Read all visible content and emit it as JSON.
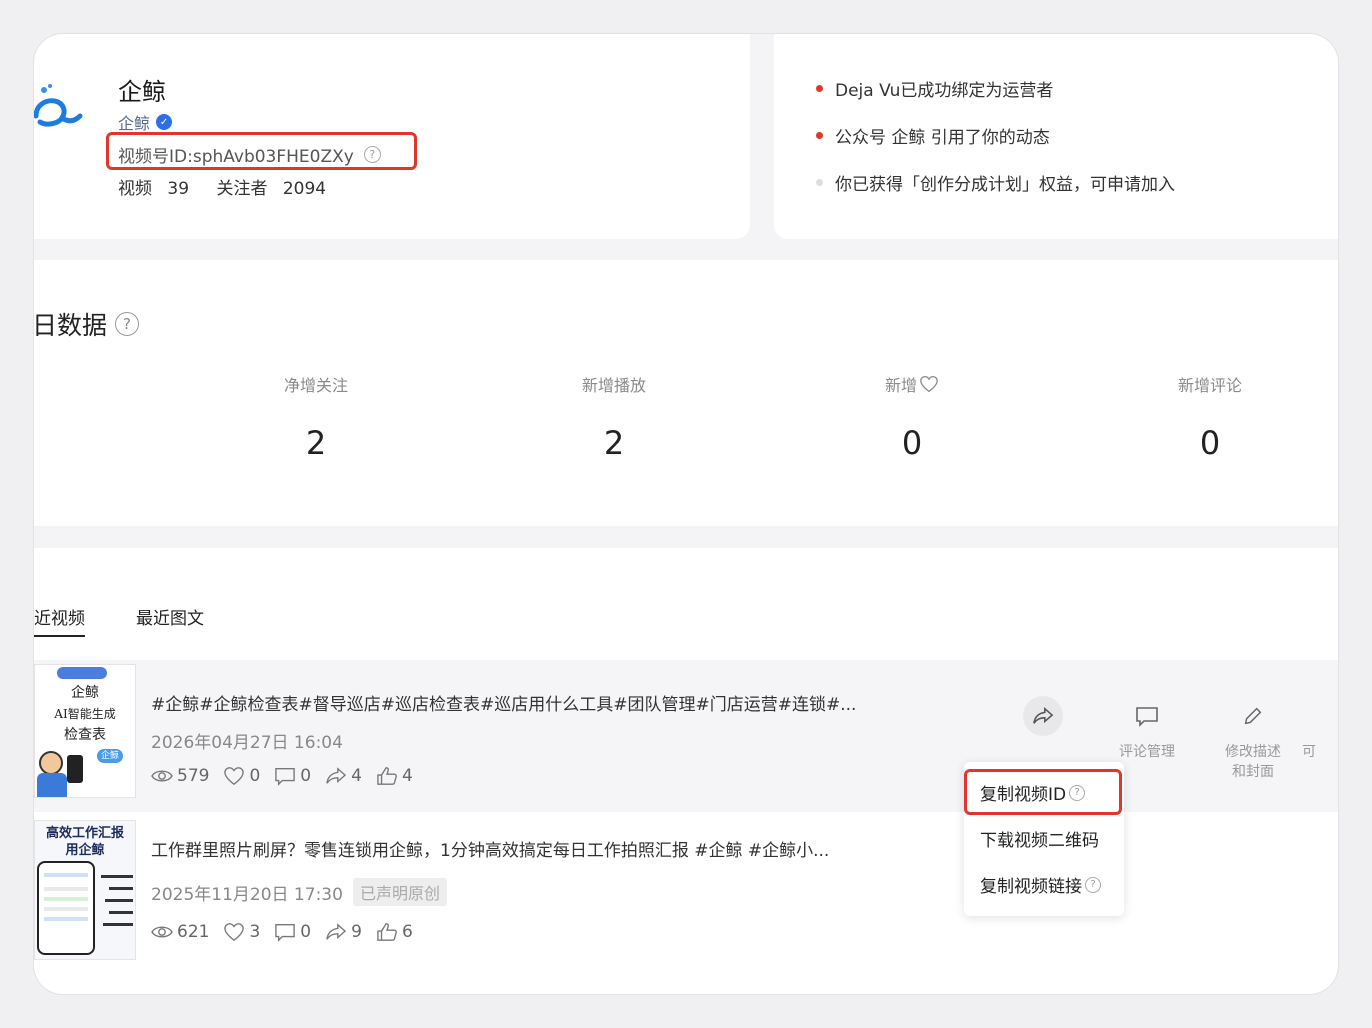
{
  "profile": {
    "name": "企鲸",
    "sub_name": "企鲸",
    "id_label": "视频号ID:sphAvb03FHE0ZXy",
    "videos_label": "视频",
    "videos_count": "39",
    "followers_label": "关注者",
    "followers_count": "2094"
  },
  "notices": [
    {
      "text": "Deja Vu已成功绑定为运营者",
      "dot_color": "#e0362c"
    },
    {
      "text": "公众号 企鲸 引用了你的动态",
      "dot_color": "#e0362c"
    },
    {
      "text": "你已获得「创作分成计划」权益，可申请加入",
      "dot_color": "#dcdcdc"
    }
  ],
  "stats": {
    "title": "日数据",
    "items": [
      {
        "label": "净增关注",
        "value": "2"
      },
      {
        "label": "新增播放",
        "value": "2"
      },
      {
        "label": "新增",
        "value": "0"
      },
      {
        "label": "新增评论",
        "value": "0"
      }
    ]
  },
  "tabs": {
    "recent_videos": "近视频",
    "recent_posts": "最近图文"
  },
  "videos": [
    {
      "title": "#企鲸#企鲸检查表#督导巡店#巡店检查表#巡店用什么工具#团队管理#门店运营#连锁#...",
      "date": "2026年04月27日 16:04",
      "views": "579",
      "likes": "0",
      "comments": "0",
      "shares": "4",
      "thumbs": "4",
      "thumb_text": [
        "企鲸",
        "AI智能生成",
        "检查表"
      ],
      "thumb_badge": "企鲸"
    },
    {
      "title": "工作群里照片刷屏？零售连锁用企鲸，1分钟高效搞定每日工作拍照汇报 #企鲸 #企鲸小...",
      "date": "2025年11月20日 17:30",
      "badge": "已声明原创",
      "views": "621",
      "likes": "3",
      "comments": "0",
      "shares": "9",
      "thumbs": "6",
      "thumb_text": [
        "高效工作汇报",
        "用企鲸"
      ]
    }
  ],
  "actions": {
    "share": "",
    "comment_manage": "评论管理",
    "edit_desc_line1": "修改描述",
    "edit_desc_line2": "和封面",
    "more": "可"
  },
  "popup": {
    "copy_id": "复制视频ID",
    "download_qr": "下载视频二维码",
    "copy_link": "复制视频链接"
  }
}
